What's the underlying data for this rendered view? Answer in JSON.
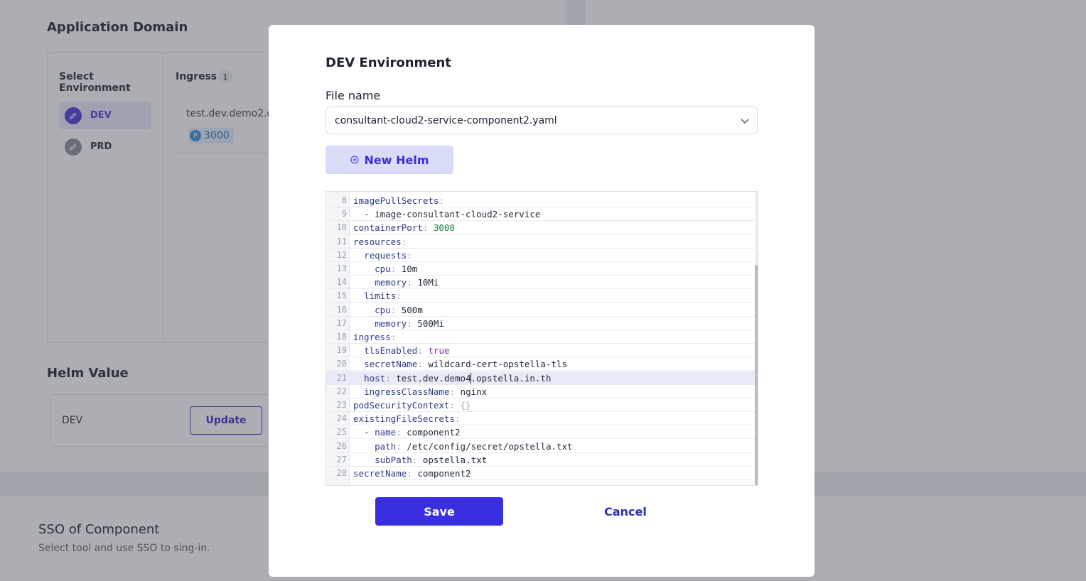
{
  "background": {
    "application_domain": {
      "title": "Application Domain",
      "select_environment_label": "Select Environment",
      "environments": [
        {
          "name": "DEV",
          "active": true
        },
        {
          "name": "PRD",
          "active": false
        }
      ],
      "ingress_label": "Ingress",
      "ingress_count": "1",
      "ingress_host": "test.dev.demo2.o",
      "port_prefix": "P",
      "port_value": "3000"
    },
    "helm_value": {
      "title": "Helm Value",
      "env": "DEV",
      "update_label": "Update"
    },
    "sso": {
      "title": "SSO of Component",
      "subtitle": "Select tool and use SSO to sing-in."
    }
  },
  "modal": {
    "title": "DEV Environment",
    "file_label": "File name",
    "file_value": "consultant-cloud2-service-component2.yaml",
    "new_helm_label": "New Helm",
    "save_label": "Save",
    "cancel_label": "Cancel",
    "editor_lines": [
      {
        "num": "8",
        "parts": [
          [
            "k",
            "imagePullSecrets"
          ],
          [
            "p",
            ":"
          ]
        ]
      },
      {
        "num": "9",
        "parts": [
          [
            "t",
            "  - image-consultant-cloud2-service"
          ]
        ]
      },
      {
        "num": "10",
        "parts": [
          [
            "k",
            "containerPort"
          ],
          [
            "p",
            ": "
          ],
          [
            "n",
            "3000"
          ]
        ]
      },
      {
        "num": "11",
        "parts": [
          [
            "k",
            "resources"
          ],
          [
            "p",
            ":"
          ]
        ]
      },
      {
        "num": "12",
        "parts": [
          [
            "t",
            "  "
          ],
          [
            "k",
            "requests"
          ],
          [
            "p",
            ":"
          ]
        ]
      },
      {
        "num": "13",
        "parts": [
          [
            "t",
            "    "
          ],
          [
            "k",
            "cpu"
          ],
          [
            "p",
            ": "
          ],
          [
            "t",
            "10m"
          ]
        ]
      },
      {
        "num": "14",
        "parts": [
          [
            "t",
            "    "
          ],
          [
            "k",
            "memory"
          ],
          [
            "p",
            ": "
          ],
          [
            "t",
            "10Mi"
          ]
        ]
      },
      {
        "num": "15",
        "parts": [
          [
            "t",
            "  "
          ],
          [
            "k",
            "limits"
          ],
          [
            "p",
            ":"
          ]
        ]
      },
      {
        "num": "16",
        "parts": [
          [
            "t",
            "    "
          ],
          [
            "k",
            "cpu"
          ],
          [
            "p",
            ": "
          ],
          [
            "t",
            "500m"
          ]
        ]
      },
      {
        "num": "17",
        "parts": [
          [
            "t",
            "    "
          ],
          [
            "k",
            "memory"
          ],
          [
            "p",
            ": "
          ],
          [
            "t",
            "500Mi"
          ]
        ]
      },
      {
        "num": "18",
        "parts": [
          [
            "k",
            "ingress"
          ],
          [
            "p",
            ":"
          ]
        ]
      },
      {
        "num": "19",
        "parts": [
          [
            "t",
            "  "
          ],
          [
            "k",
            "tlsEnabled"
          ],
          [
            "p",
            ": "
          ],
          [
            "b",
            "true"
          ]
        ]
      },
      {
        "num": "20",
        "parts": [
          [
            "t",
            "  "
          ],
          [
            "k",
            "secretName"
          ],
          [
            "p",
            ": "
          ],
          [
            "t",
            "wildcard-cert-opstella-tls"
          ]
        ]
      },
      {
        "num": "21",
        "highlight": true,
        "parts": [
          [
            "t",
            "  "
          ],
          [
            "k",
            "host"
          ],
          [
            "p",
            ": "
          ],
          [
            "t",
            "test.dev.demo4"
          ],
          [
            "c",
            ""
          ],
          [
            "t",
            ".opstella.in.th"
          ]
        ]
      },
      {
        "num": "22",
        "parts": [
          [
            "t",
            "  "
          ],
          [
            "k",
            "ingressClassName"
          ],
          [
            "p",
            ": "
          ],
          [
            "t",
            "nginx"
          ]
        ]
      },
      {
        "num": "23",
        "parts": [
          [
            "k",
            "podSecurityContext"
          ],
          [
            "p",
            ": {}"
          ]
        ]
      },
      {
        "num": "24",
        "parts": [
          [
            "k",
            "existingFileSecrets"
          ],
          [
            "p",
            ":"
          ]
        ]
      },
      {
        "num": "25",
        "parts": [
          [
            "t",
            "  - "
          ],
          [
            "k",
            "name"
          ],
          [
            "p",
            ": "
          ],
          [
            "t",
            "component2"
          ]
        ]
      },
      {
        "num": "26",
        "parts": [
          [
            "t",
            "    "
          ],
          [
            "k",
            "path"
          ],
          [
            "p",
            ": "
          ],
          [
            "t",
            "/etc/config/secret/opstella.txt"
          ]
        ]
      },
      {
        "num": "27",
        "parts": [
          [
            "t",
            "    "
          ],
          [
            "k",
            "subPath"
          ],
          [
            "p",
            ": "
          ],
          [
            "t",
            "opstella.txt"
          ]
        ]
      },
      {
        "num": "28",
        "parts": [
          [
            "k",
            "secretName"
          ],
          [
            "p",
            ": "
          ],
          [
            "t",
            "component2"
          ]
        ]
      }
    ]
  }
}
